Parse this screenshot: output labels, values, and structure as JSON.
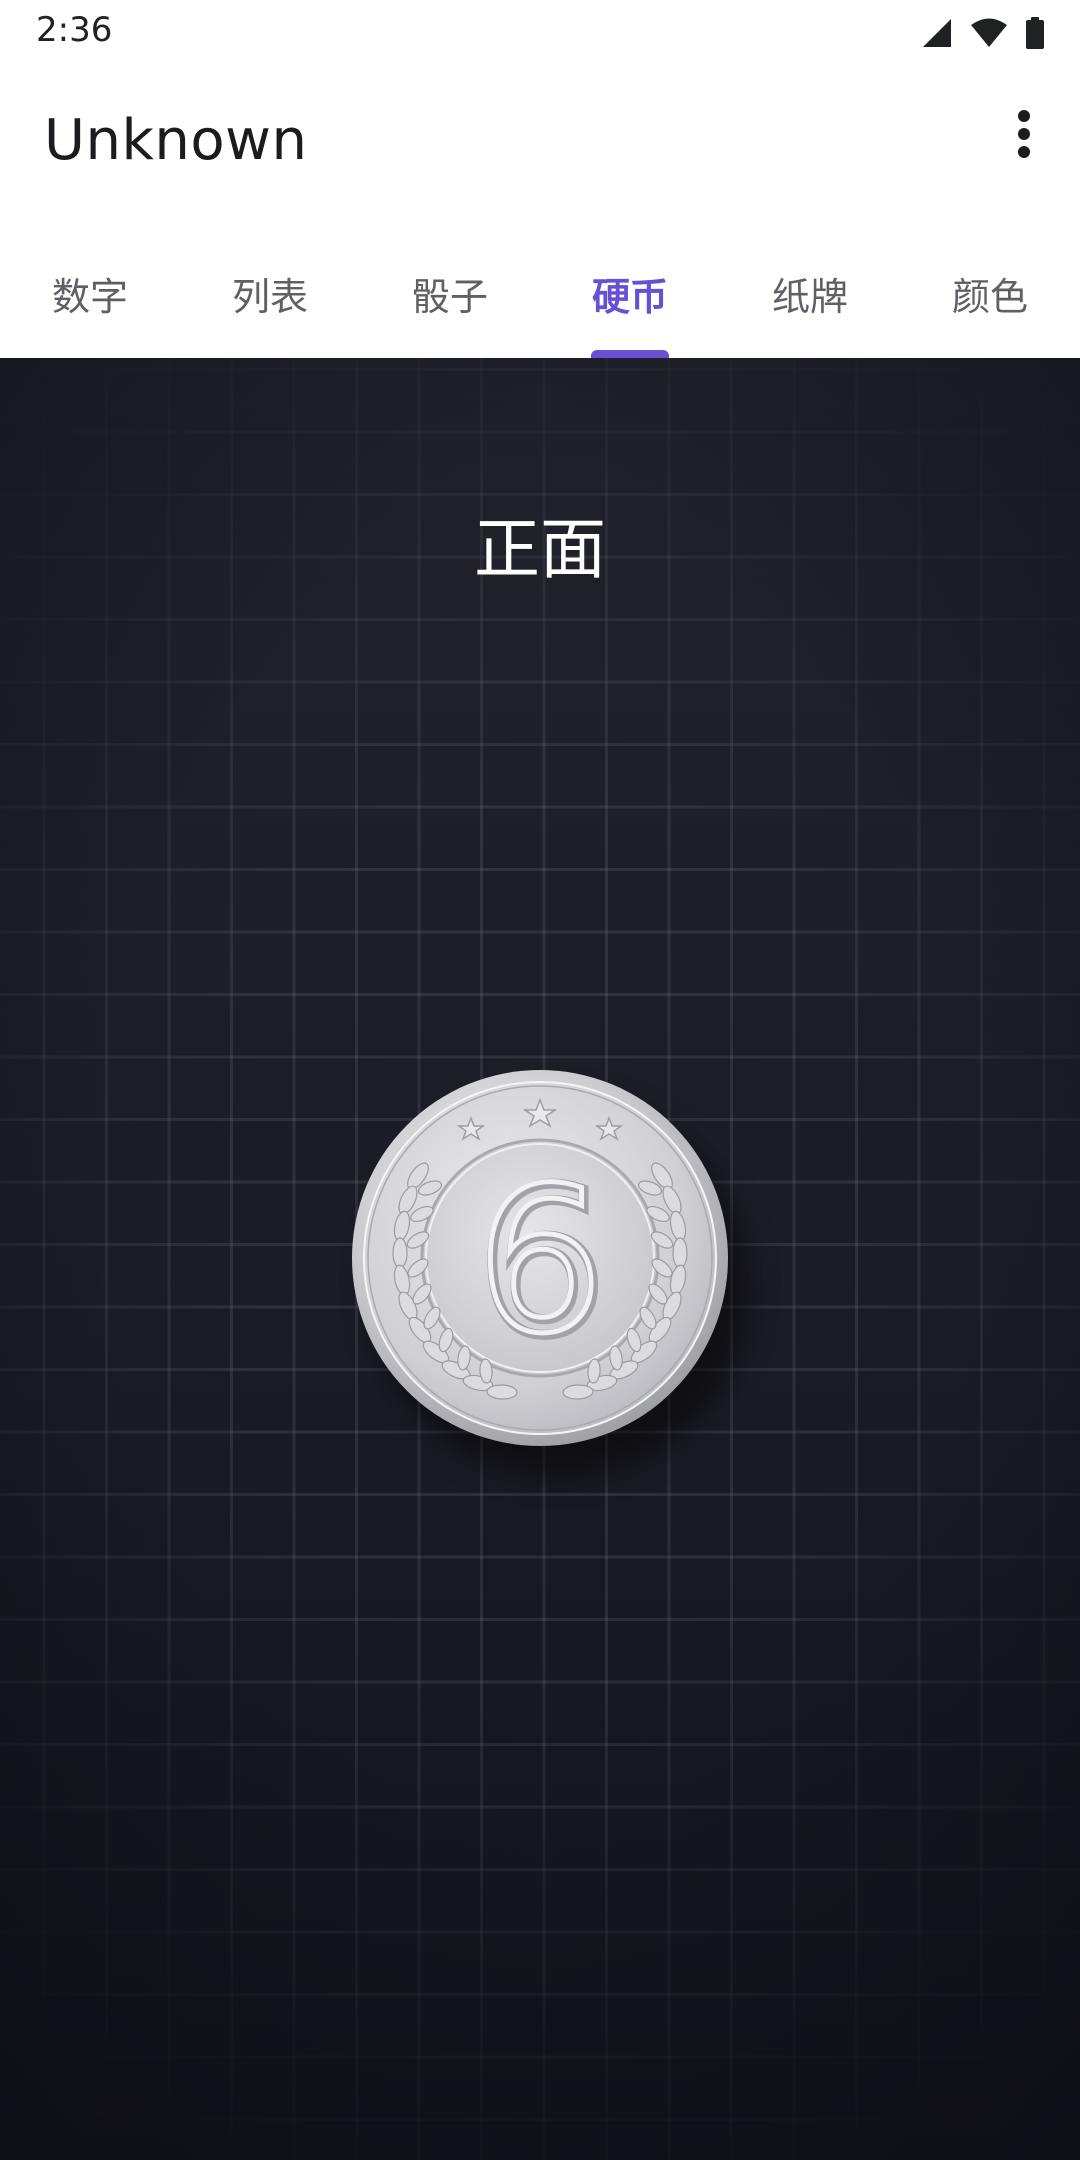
{
  "status_bar": {
    "time": "2:36",
    "icons": [
      "signal-icon",
      "wifi-icon",
      "battery-icon"
    ]
  },
  "app_bar": {
    "title": "Unknown",
    "menu_icon": "more-vert-icon"
  },
  "tabs": [
    {
      "label": "数字",
      "active": false
    },
    {
      "label": "列表",
      "active": false
    },
    {
      "label": "骰子",
      "active": false
    },
    {
      "label": "硬币",
      "active": true
    },
    {
      "label": "纸牌",
      "active": false
    },
    {
      "label": "颜色",
      "active": false
    }
  ],
  "coin_screen": {
    "result": "正面",
    "coin_face_number": "6"
  },
  "colors": {
    "accent": "#6750d6",
    "background_dark": "#1b1b24",
    "coin_silver": "#d4d4d8"
  }
}
